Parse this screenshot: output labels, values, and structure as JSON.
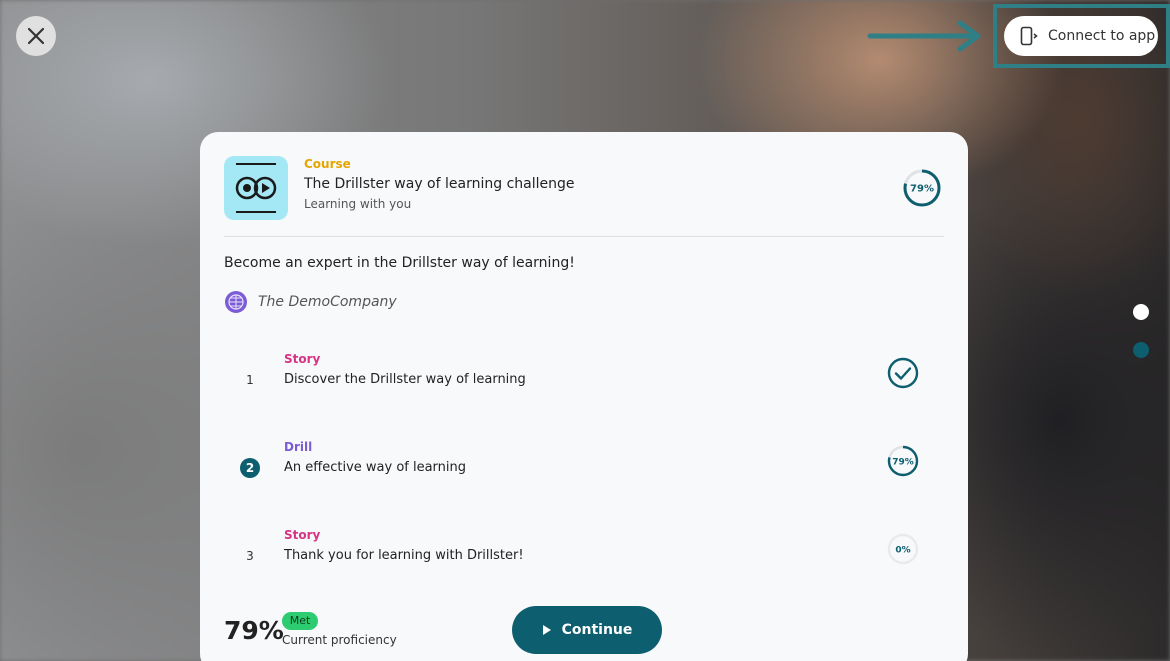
{
  "header": {
    "connect_label": "Connect to app"
  },
  "course": {
    "type": "Course",
    "title": "The Drillster way of learning challenge",
    "subtitle": "Learning with you",
    "progress_label": "79%",
    "progress": 0.79,
    "description": "Become an expert in the Drillster way of learning!",
    "organization": "The DemoCompany"
  },
  "steps": [
    {
      "number": "1",
      "type": "Story",
      "title": "Discover the Drillster way of learning",
      "status": "completed"
    },
    {
      "number": "2",
      "type": "Drill",
      "title": "An effective way of learning",
      "status_label": "79%",
      "progress": 0.79
    },
    {
      "number": "3",
      "type": "Story",
      "title": "Thank you for learning with Drillster!",
      "status_label": "0%",
      "progress": 0
    }
  ],
  "footer": {
    "proficiency_value": "79%",
    "badge": "Met",
    "proficiency_label": "Current proficiency",
    "continue_label": "Continue"
  },
  "colors": {
    "accent": "#0d5e6e",
    "course_type": "#e6a500",
    "story_type": "#d63384",
    "drill_type": "#7b5cd6",
    "badge_green": "#2ecc71",
    "highlight": "#2e7f86"
  },
  "icons": {
    "close": "close-icon",
    "connect": "phone-connect-icon",
    "org": "globe-icon",
    "completed": "check-circle-icon",
    "continue": "play-icon"
  }
}
